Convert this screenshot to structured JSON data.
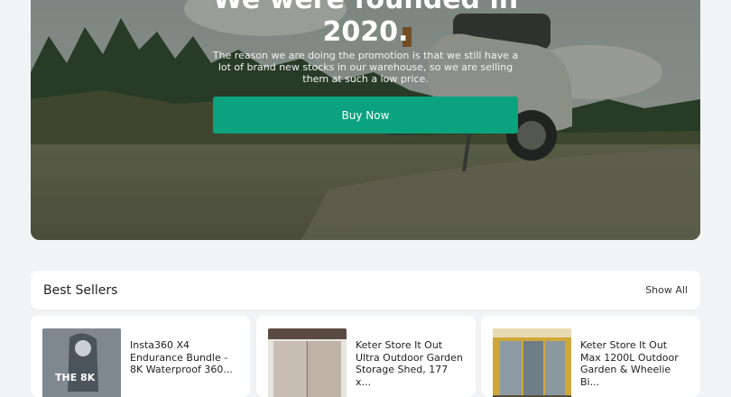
{
  "hero": {
    "title_line1": "We were founded in",
    "title_line2": "2020.",
    "description": "The reason we are doing the promotion is that we still have a lot of brand new stocks in our warehouse, so we are selling them at such a low price.",
    "button_label": "Buy Now"
  },
  "best_sellers": {
    "title": "Best Sellers",
    "show_all_label": "Show All",
    "products": [
      {
        "name": "Insta360 X4 Endurance Bundle - 8K Waterproof 360...",
        "thumb_text": "THE 8K"
      },
      {
        "name": "Keter Store It Out Ultra Outdoor Garden Storage Shed, 177 x..."
      },
      {
        "name": "Keter Store It Out Max 1200L Outdoor Garden & Wheelie Bi..."
      }
    ]
  },
  "colors": {
    "accent": "#0ba37f",
    "page_background": "#f2f3f5"
  }
}
